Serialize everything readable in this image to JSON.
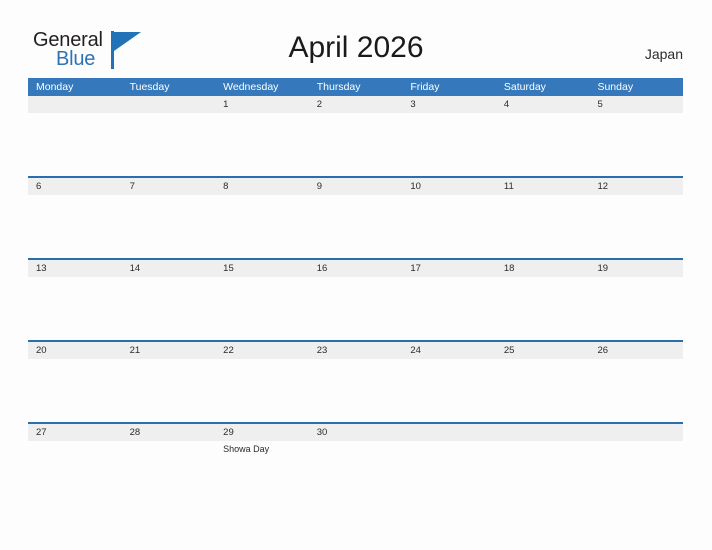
{
  "logo": {
    "word_one": "General",
    "word_two": "Blue"
  },
  "header": {
    "title": "April 2026",
    "country": "Japan"
  },
  "calendar": {
    "weekdays": [
      "Monday",
      "Tuesday",
      "Wednesday",
      "Thursday",
      "Friday",
      "Saturday",
      "Sunday"
    ],
    "weeks": [
      {
        "days": [
          {
            "date": "",
            "events": []
          },
          {
            "date": "",
            "events": []
          },
          {
            "date": "1",
            "events": []
          },
          {
            "date": "2",
            "events": []
          },
          {
            "date": "3",
            "events": []
          },
          {
            "date": "4",
            "events": []
          },
          {
            "date": "5",
            "events": []
          }
        ]
      },
      {
        "days": [
          {
            "date": "6",
            "events": []
          },
          {
            "date": "7",
            "events": []
          },
          {
            "date": "8",
            "events": []
          },
          {
            "date": "9",
            "events": []
          },
          {
            "date": "10",
            "events": []
          },
          {
            "date": "11",
            "events": []
          },
          {
            "date": "12",
            "events": []
          }
        ]
      },
      {
        "days": [
          {
            "date": "13",
            "events": []
          },
          {
            "date": "14",
            "events": []
          },
          {
            "date": "15",
            "events": []
          },
          {
            "date": "16",
            "events": []
          },
          {
            "date": "17",
            "events": []
          },
          {
            "date": "18",
            "events": []
          },
          {
            "date": "19",
            "events": []
          }
        ]
      },
      {
        "days": [
          {
            "date": "20",
            "events": []
          },
          {
            "date": "21",
            "events": []
          },
          {
            "date": "22",
            "events": []
          },
          {
            "date": "23",
            "events": []
          },
          {
            "date": "24",
            "events": []
          },
          {
            "date": "25",
            "events": []
          },
          {
            "date": "26",
            "events": []
          }
        ]
      },
      {
        "days": [
          {
            "date": "27",
            "events": []
          },
          {
            "date": "28",
            "events": []
          },
          {
            "date": "29",
            "events": [
              "Showa Day"
            ]
          },
          {
            "date": "30",
            "events": []
          },
          {
            "date": "",
            "events": []
          },
          {
            "date": "",
            "events": []
          },
          {
            "date": "",
            "events": []
          }
        ]
      }
    ]
  },
  "colors": {
    "header_blue": "#3579bc",
    "separator_blue": "#2a6ead",
    "date_band": "#efefef",
    "logo_blue": "#2272b8"
  }
}
